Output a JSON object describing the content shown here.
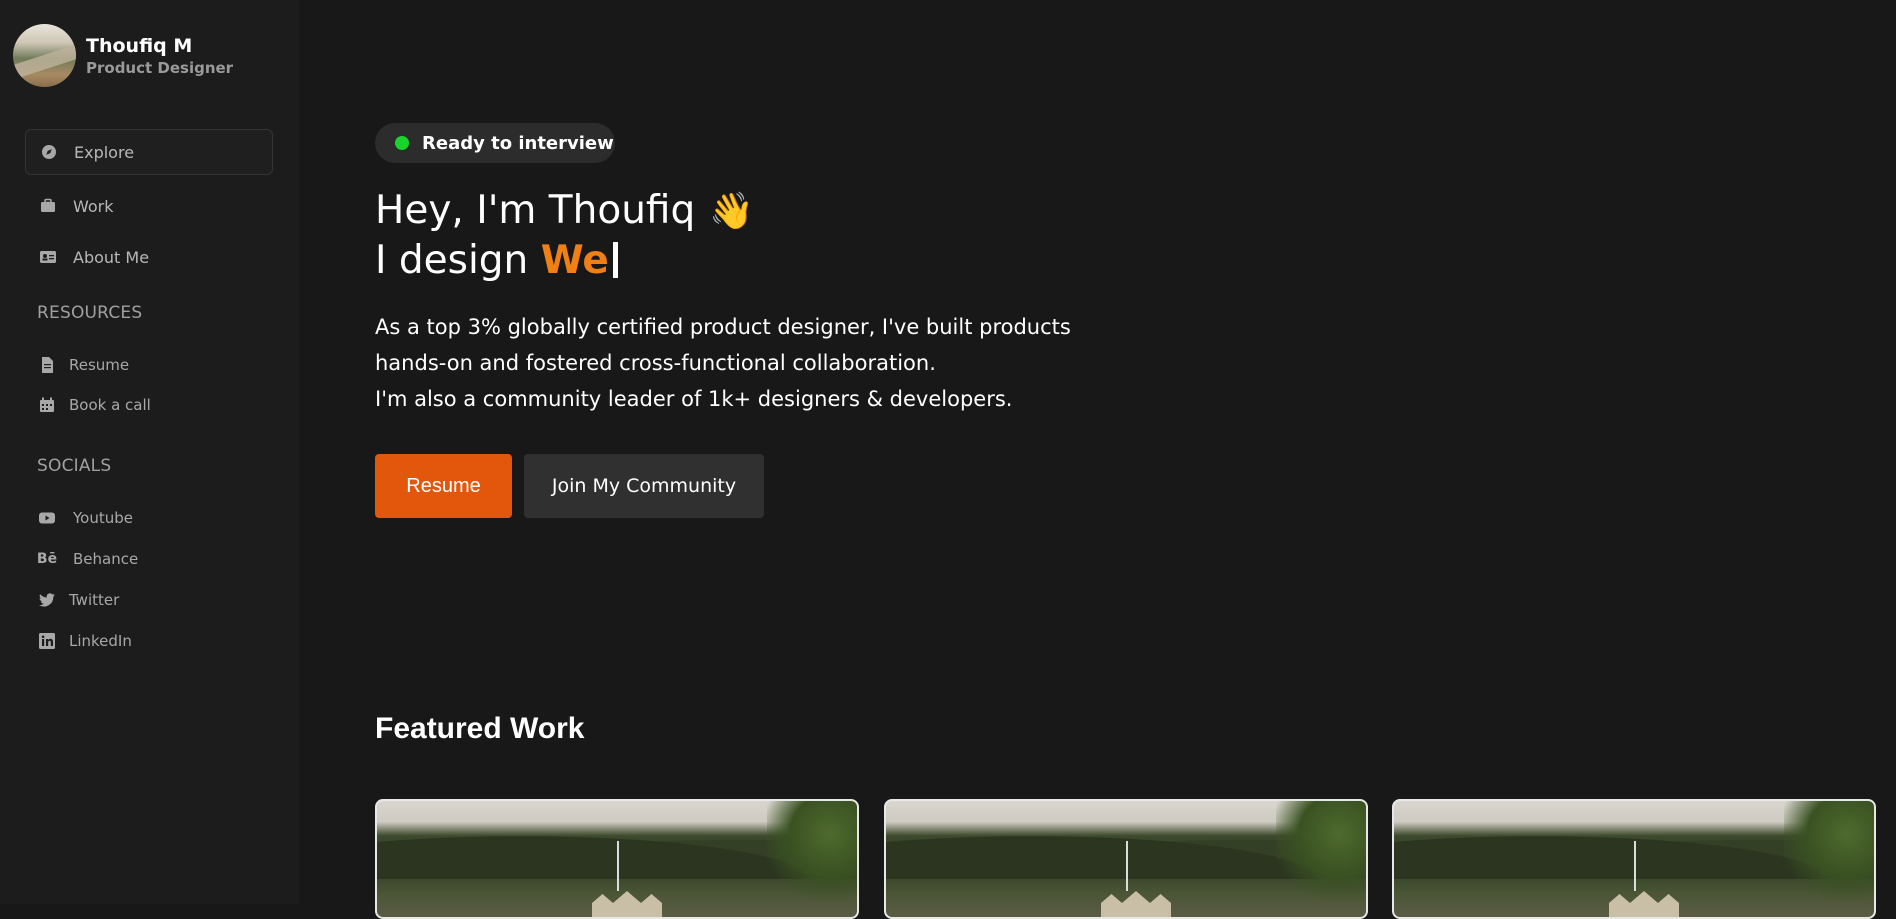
{
  "profile": {
    "name": "Thoufiq M",
    "role": "Product Designer"
  },
  "nav": [
    {
      "label": "Explore",
      "icon": "compass-icon",
      "active": true
    },
    {
      "label": "Work",
      "icon": "briefcase-icon",
      "active": false
    },
    {
      "label": "About Me",
      "icon": "id-card-icon",
      "active": false
    }
  ],
  "resources": {
    "heading": "RESOURCES",
    "items": [
      {
        "label": "Resume",
        "icon": "file-icon"
      },
      {
        "label": "Book a call",
        "icon": "calendar-icon"
      }
    ]
  },
  "socials": {
    "heading": "SOCIALS",
    "items": [
      {
        "label": "Youtube",
        "icon": "youtube-icon"
      },
      {
        "label": "Behance",
        "icon": "behance-icon"
      },
      {
        "label": "Twitter",
        "icon": "twitter-icon"
      },
      {
        "label": "LinkedIn",
        "icon": "linkedin-icon"
      }
    ]
  },
  "hero": {
    "status": "Ready to interview",
    "status_color": "#19d42b",
    "greeting": "Hey, I'm Thoufiq",
    "wave_emoji": "👋",
    "design_prefix": "I design ",
    "design_typed": "We",
    "accent_color": "#f08016",
    "intro_lines": [
      "As a top 3% globally certified product designer, I've built products",
      "hands-on and fostered cross-functional collaboration.",
      "I'm also a community leader of 1k+ designers & developers."
    ],
    "primary_button": "Resume",
    "primary_color": "#e2570c",
    "secondary_button": "Join My Community"
  },
  "featured": {
    "title": "Featured Work"
  }
}
